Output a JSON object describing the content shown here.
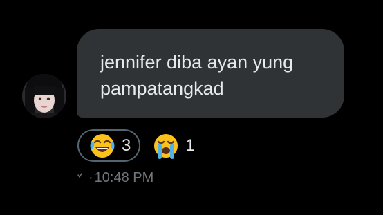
{
  "message": {
    "text_line1": "jennifer diba ayan yung",
    "text_line2": "pampatangkad",
    "avatar": "user-avatar-photo"
  },
  "reactions": [
    {
      "icon": "face-with-tears-of-joy-emoji",
      "count": "3"
    },
    {
      "icon": "loudly-crying-face-emoji",
      "count": "1"
    }
  ],
  "meta": {
    "status_icon": "sent-status-icon",
    "separator": "·",
    "timestamp": "10:48 PM"
  },
  "colors": {
    "background": "#000000",
    "bubble": "#2f3336",
    "text": "#e7e9ea",
    "muted": "#71767b",
    "pill_border": "#536471"
  }
}
